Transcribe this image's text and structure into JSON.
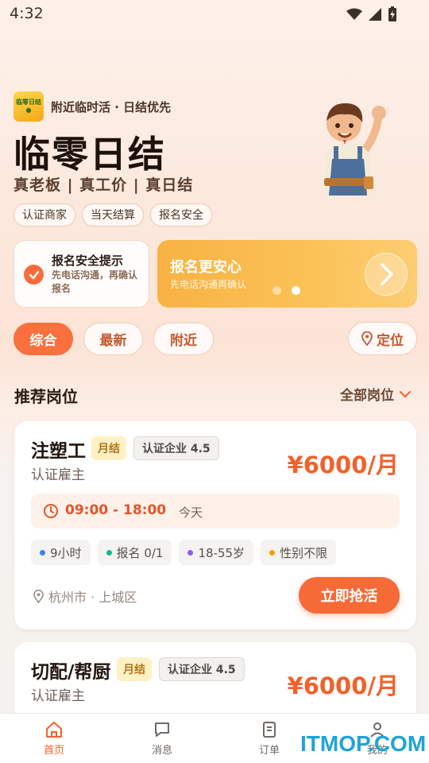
{
  "status_bar": {
    "time": "4:32"
  },
  "hero": {
    "logo_text": "临零日结",
    "tagline": "附近临时活 · 日结优先",
    "app_name": "临零日结",
    "slogan": "真老板 | 真工价 | 真日结",
    "chips": [
      "认证商家",
      "当天结算",
      "报名安全"
    ]
  },
  "safety_card": {
    "title": "报名安全提示",
    "desc": "先电话沟通，再确认报名"
  },
  "banner": {
    "title": "报名更安心",
    "subtitle": "先电话沟通再确认",
    "active_slide": 2,
    "slide_count": 2
  },
  "filters": {
    "tabs": [
      "综合",
      "最新",
      "附近"
    ],
    "active": "综合",
    "locate_label": "定位"
  },
  "section": {
    "title": "推荐岗位",
    "all_label": "全部岗位"
  },
  "jobs": [
    {
      "title": "注塑工",
      "pay_type": "月结",
      "cert": "认证企业 4.5",
      "employer": "认证雇主",
      "salary": "¥6000/月",
      "time": "09:00 - 18:00",
      "day": "今天",
      "tags": [
        "9小时",
        "报名 0/1",
        "18-55岁",
        "性别不限"
      ],
      "location": "杭州市 · 上城区",
      "action": "立即抢活"
    },
    {
      "title": "切配/帮厨",
      "pay_type": "月结",
      "cert": "认证企业 4.5",
      "employer": "认证雇主",
      "salary": "¥6000/月"
    }
  ],
  "colors": {
    "accent": "#f66a37",
    "tag_dots": [
      "#3b82f6",
      "#14b88a",
      "#8b5cf6",
      "#f59e0b"
    ]
  },
  "bottom_nav": {
    "items": [
      "首页",
      "消息",
      "订单",
      "我的"
    ],
    "active": "首页"
  },
  "watermark": "ITMOP.COM"
}
